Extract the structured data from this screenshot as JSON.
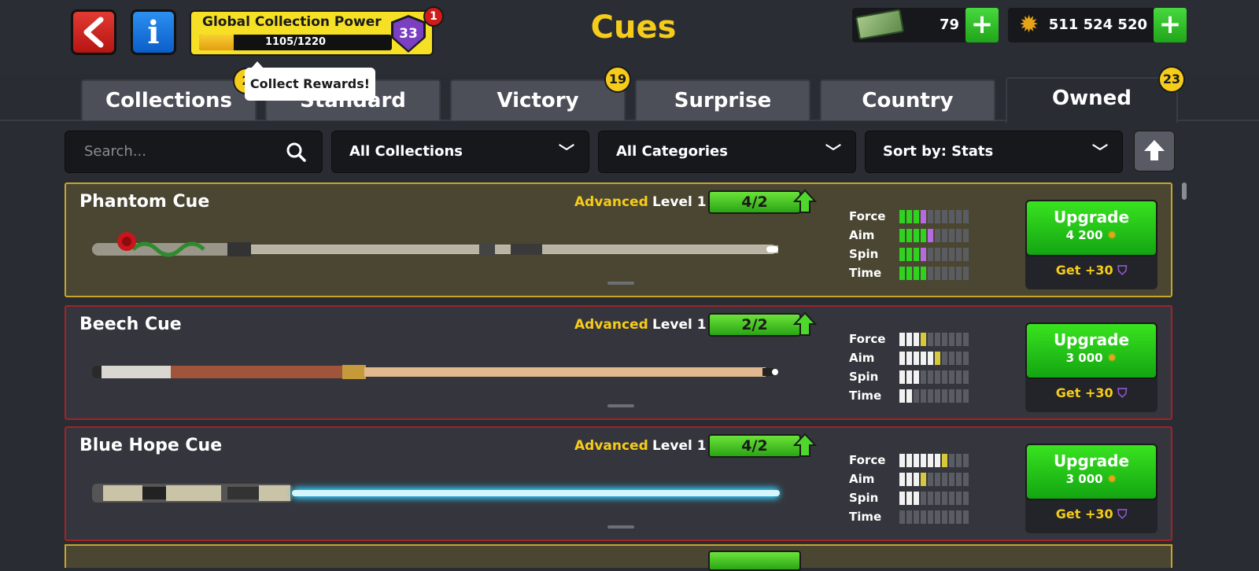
{
  "header": {
    "title": "Cues",
    "gcp_title": "Global Collection Power",
    "gcp_progress": "1105/1220",
    "gcp_current": 1105,
    "gcp_max": 1220,
    "gcp_level": "33",
    "notification_count": "1",
    "cash": "79",
    "coins": "511 524 520",
    "tooltip": "Collect Rewards!"
  },
  "tabs": [
    {
      "label": "Collections",
      "badge": "2"
    },
    {
      "label": "Standard",
      "badge": ""
    },
    {
      "label": "Victory",
      "badge": "19"
    },
    {
      "label": "Surprise",
      "badge": ""
    },
    {
      "label": "Country",
      "badge": ""
    },
    {
      "label": "Owned",
      "badge": "23",
      "active": true
    }
  ],
  "filters": {
    "search_placeholder": "Search...",
    "collections": "All Collections",
    "categories": "All Categories",
    "sort": "Sort by: Stats"
  },
  "stat_labels": [
    "Force",
    "Aim",
    "Spin",
    "Time"
  ],
  "cues": [
    {
      "name": "Phantom Cue",
      "tier": "Advanced",
      "level": "Level 1",
      "progress": "4/2",
      "upgrade_label": "Upgrade",
      "upgrade_cost": "4 200",
      "get_label": "Get +30",
      "stats": [
        {
          "white": 3,
          "color": 1,
          "colorHex": "#b56be0"
        },
        {
          "white": 4,
          "color": 1,
          "colorHex": "#b56be0"
        },
        {
          "white": 3,
          "color": 1,
          "colorHex": "#b56be0"
        },
        {
          "white": 4,
          "color": 0,
          "colorHex": "#b56be0"
        }
      ]
    },
    {
      "name": "Beech Cue",
      "tier": "Advanced",
      "level": "Level 1",
      "progress": "2/2",
      "upgrade_label": "Upgrade",
      "upgrade_cost": "3 000",
      "get_label": "Get +30",
      "stats": [
        {
          "white": 3,
          "color": 1,
          "colorHex": "#d7c93a"
        },
        {
          "white": 5,
          "color": 1,
          "colorHex": "#d7c93a"
        },
        {
          "white": 3,
          "color": 0,
          "colorHex": "#d7c93a"
        },
        {
          "white": 2,
          "color": 0,
          "colorHex": "#d7c93a"
        }
      ]
    },
    {
      "name": "Blue Hope Cue",
      "tier": "Advanced",
      "level": "Level 1",
      "progress": "4/2",
      "upgrade_label": "Upgrade",
      "upgrade_cost": "3 000",
      "get_label": "Get +30",
      "stats": [
        {
          "white": 6,
          "color": 1,
          "colorHex": "#d7c93a"
        },
        {
          "white": 3,
          "color": 1,
          "colorHex": "#d7c93a"
        },
        {
          "white": 3,
          "color": 0,
          "colorHex": "#d7c93a"
        },
        {
          "white": 0,
          "color": 0,
          "colorHex": "#d7c93a"
        }
      ]
    }
  ],
  "colors": {
    "accent_yellow": "#f6cc1b",
    "upgrade_green": "#1fbf18",
    "stat_green": "#2fd21e",
    "card_gold_border": "#c6a62a",
    "card_red_border": "#a32227"
  }
}
